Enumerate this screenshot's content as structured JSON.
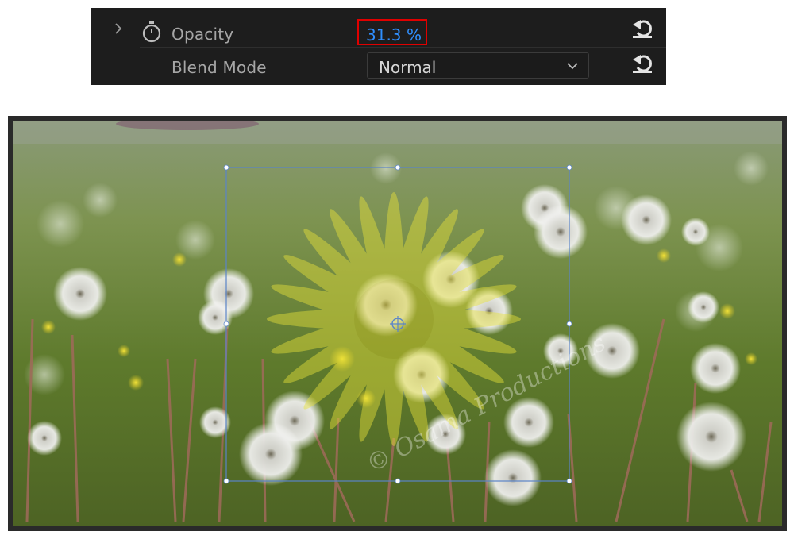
{
  "effect_controls": {
    "opacity": {
      "label": "Opacity",
      "value": "31.3",
      "unit": "%",
      "stopwatch_icon": "stopwatch-icon",
      "expand_icon": "chevron-right-icon",
      "reset_icon": "reset-icon"
    },
    "blend_mode": {
      "label": "Blend Mode",
      "value": "Normal",
      "dropdown_icon": "chevron-down-icon",
      "reset_icon": "reset-icon"
    },
    "highlight_color": "#e00000",
    "value_color": "#2f8fff"
  },
  "preview": {
    "overlay_opacity": 0.313,
    "watermark": "© Osama Productions"
  }
}
